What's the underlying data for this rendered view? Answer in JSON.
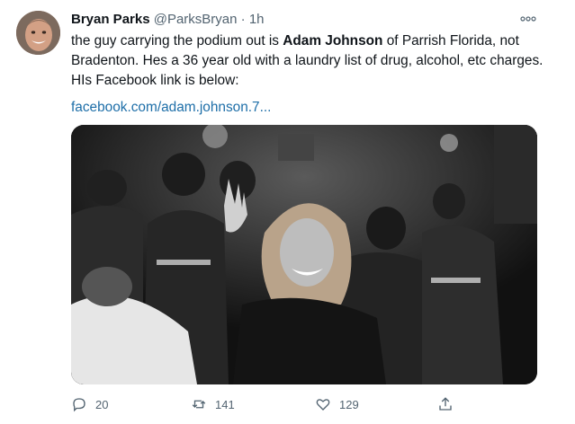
{
  "tweet": {
    "author_name": "Bryan Parks",
    "handle": "@ParksBryan",
    "separator": "·",
    "time": "1h",
    "text_before": "the guy carrying the podium out is ",
    "text_highlight": "Adam Johnson",
    "text_after": " of Parrish Florida, not Bradenton. Hes a 36 year old with a laundry list of drug, alcohol, etc charges. HIs Facebook link is below:",
    "link_text": "facebook.com/adam.johnson.7..."
  },
  "actions": {
    "reply_count": "20",
    "retweet_count": "141",
    "like_count": "129"
  },
  "icons": {
    "more": "more-horizontal-icon",
    "reply": "reply-icon",
    "retweet": "retweet-icon",
    "like": "heart-icon",
    "share": "share-icon"
  },
  "colors": {
    "link": "#1d6ea8",
    "muted": "#536471",
    "text": "#0f1419"
  }
}
